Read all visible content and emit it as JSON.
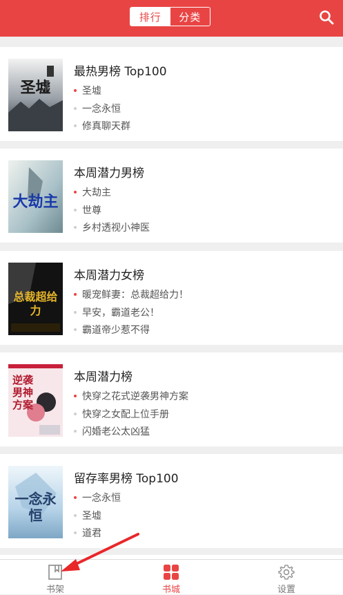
{
  "header": {
    "tabs": [
      {
        "label": "排行",
        "active": true
      },
      {
        "label": "分类",
        "active": false
      }
    ],
    "search_icon": "search-icon",
    "accent_color": "#e94444"
  },
  "rankings": [
    {
      "title": "最热男榜 Top100",
      "cover_text": "圣墟",
      "books": [
        "圣墟",
        "一念永恒",
        "修真聊天群"
      ]
    },
    {
      "title": "本周潜力男榜",
      "cover_text": "大劫主",
      "books": [
        "大劫主",
        "世尊",
        "乡村透视小神医"
      ]
    },
    {
      "title": "本周潜力女榜",
      "cover_text": "总裁超给力",
      "books": [
        "暖宠鲜妻：总裁超给力！",
        "早安，霸道老公！",
        "霸道帝少惹不得"
      ]
    },
    {
      "title": "本周潜力榜",
      "cover_text": "逆袭男神方案",
      "books": [
        "快穿之花式逆袭男神方案",
        "快穿之女配上位手册",
        "闪婚老公太凶猛"
      ]
    },
    {
      "title": "留存率男榜 Top100",
      "cover_text": "一念永恒",
      "books": [
        "一念永恒",
        "圣墟",
        "道君"
      ]
    }
  ],
  "tabbar": {
    "items": [
      {
        "label": "书架",
        "icon": "bookmark-book-icon",
        "active": false
      },
      {
        "label": "书城",
        "icon": "grid-store-icon",
        "active": true
      },
      {
        "label": "设置",
        "icon": "gear-icon",
        "active": false
      }
    ]
  }
}
